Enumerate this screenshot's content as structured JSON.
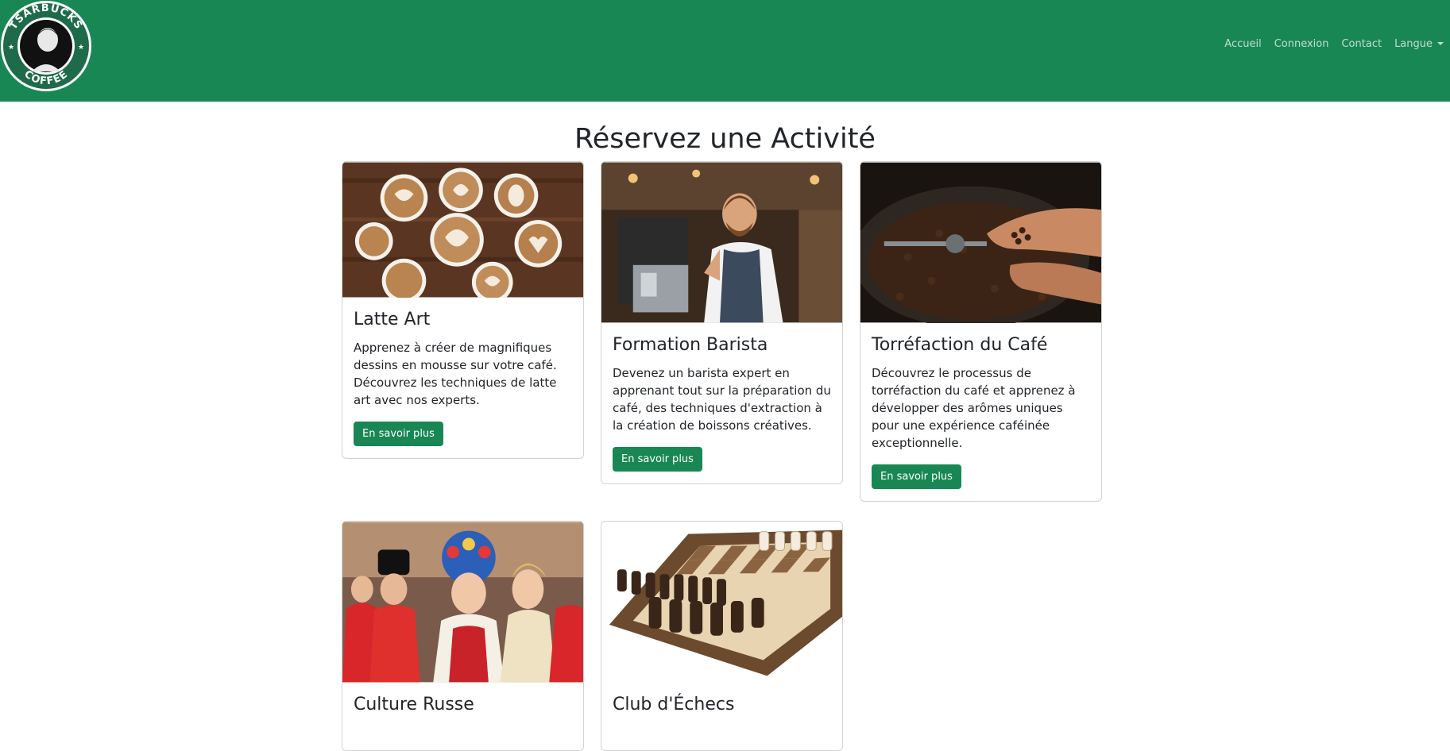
{
  "brand": {
    "logo_top": "TSARBUCKS",
    "logo_bottom": "COFFEE",
    "primary_color": "#198754"
  },
  "nav": {
    "items": [
      {
        "label": "Accueil"
      },
      {
        "label": "Connexion"
      },
      {
        "label": "Contact"
      },
      {
        "label": "Langue"
      }
    ]
  },
  "page": {
    "title": "Réservez une Activité"
  },
  "cards": [
    {
      "title": "Latte Art",
      "text": "Apprenez à créer de magnifiques dessins en mousse sur votre café. Découvrez les techniques de latte art avec nos experts.",
      "button": "En savoir plus"
    },
    {
      "title": "Formation Barista",
      "text": "Devenez un barista expert en apprenant tout sur la préparation du café, des techniques d'extraction à la création de boissons créatives.",
      "button": "En savoir plus"
    },
    {
      "title": "Torréfaction du Café",
      "text": "Découvrez le processus de torréfaction du café et apprenez à développer des arômes uniques pour une expérience caféinée exceptionnelle.",
      "button": "En savoir plus"
    },
    {
      "title": "Culture Russe"
    },
    {
      "title": "Club d'Échecs"
    }
  ]
}
